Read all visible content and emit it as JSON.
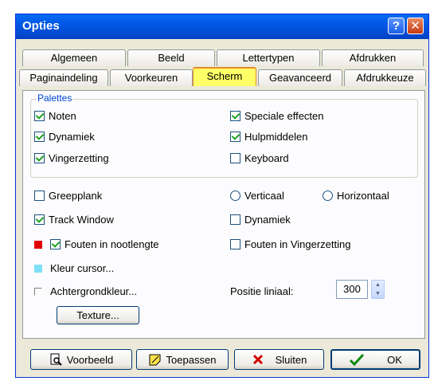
{
  "window": {
    "title": "Opties",
    "help_label": "?",
    "close_label": "✕"
  },
  "tabs_row1": [
    "Algemeen",
    "Beeld",
    "Lettertypen",
    "Afdrukken"
  ],
  "tabs_row2": [
    "Paginaindeling",
    "Voorkeuren",
    "Scherm",
    "Geavanceerd",
    "Afdrukkeuze"
  ],
  "active_tab": "Scherm",
  "palettes": {
    "label": "Palettes",
    "items": [
      {
        "label": "Noten",
        "checked": true
      },
      {
        "label": "Speciale effecten",
        "checked": true
      },
      {
        "label": "Dynamiek",
        "checked": true
      },
      {
        "label": "Hulpmiddelen",
        "checked": true
      },
      {
        "label": "Vingerzetting",
        "checked": true
      },
      {
        "label": "Keyboard",
        "checked": false
      }
    ]
  },
  "options": {
    "greepplank": {
      "label": "Greepplank",
      "checked": false
    },
    "verticaal": {
      "label": "Verticaal",
      "selected": false
    },
    "horizontaal": {
      "label": "Horizontaal",
      "selected": false
    },
    "track_window": {
      "label": "Track Window",
      "checked": true
    },
    "dynamiek": {
      "label": "Dynamiek",
      "checked": false
    },
    "fouten_nootlengte": {
      "label": "Fouten in nootlengte",
      "checked": true,
      "color": "#e00000"
    },
    "fouten_vingerzetting": {
      "label": "Fouten in Vingerzetting",
      "checked": false
    },
    "kleur_cursor": {
      "label": "Kleur cursor...",
      "color": "#7fe0f8"
    },
    "achtergrondkleur": {
      "label": "Achtergrondkleur...",
      "color": "#fcfcfe"
    },
    "positie_liniaal": {
      "label": "Positie liniaal:",
      "value": "300"
    },
    "texture_button": "Texture..."
  },
  "buttons": {
    "voorbeeld": "Voorbeeld",
    "toepassen": "Toepassen",
    "sluiten": "Sluiten",
    "ok": "OK"
  }
}
